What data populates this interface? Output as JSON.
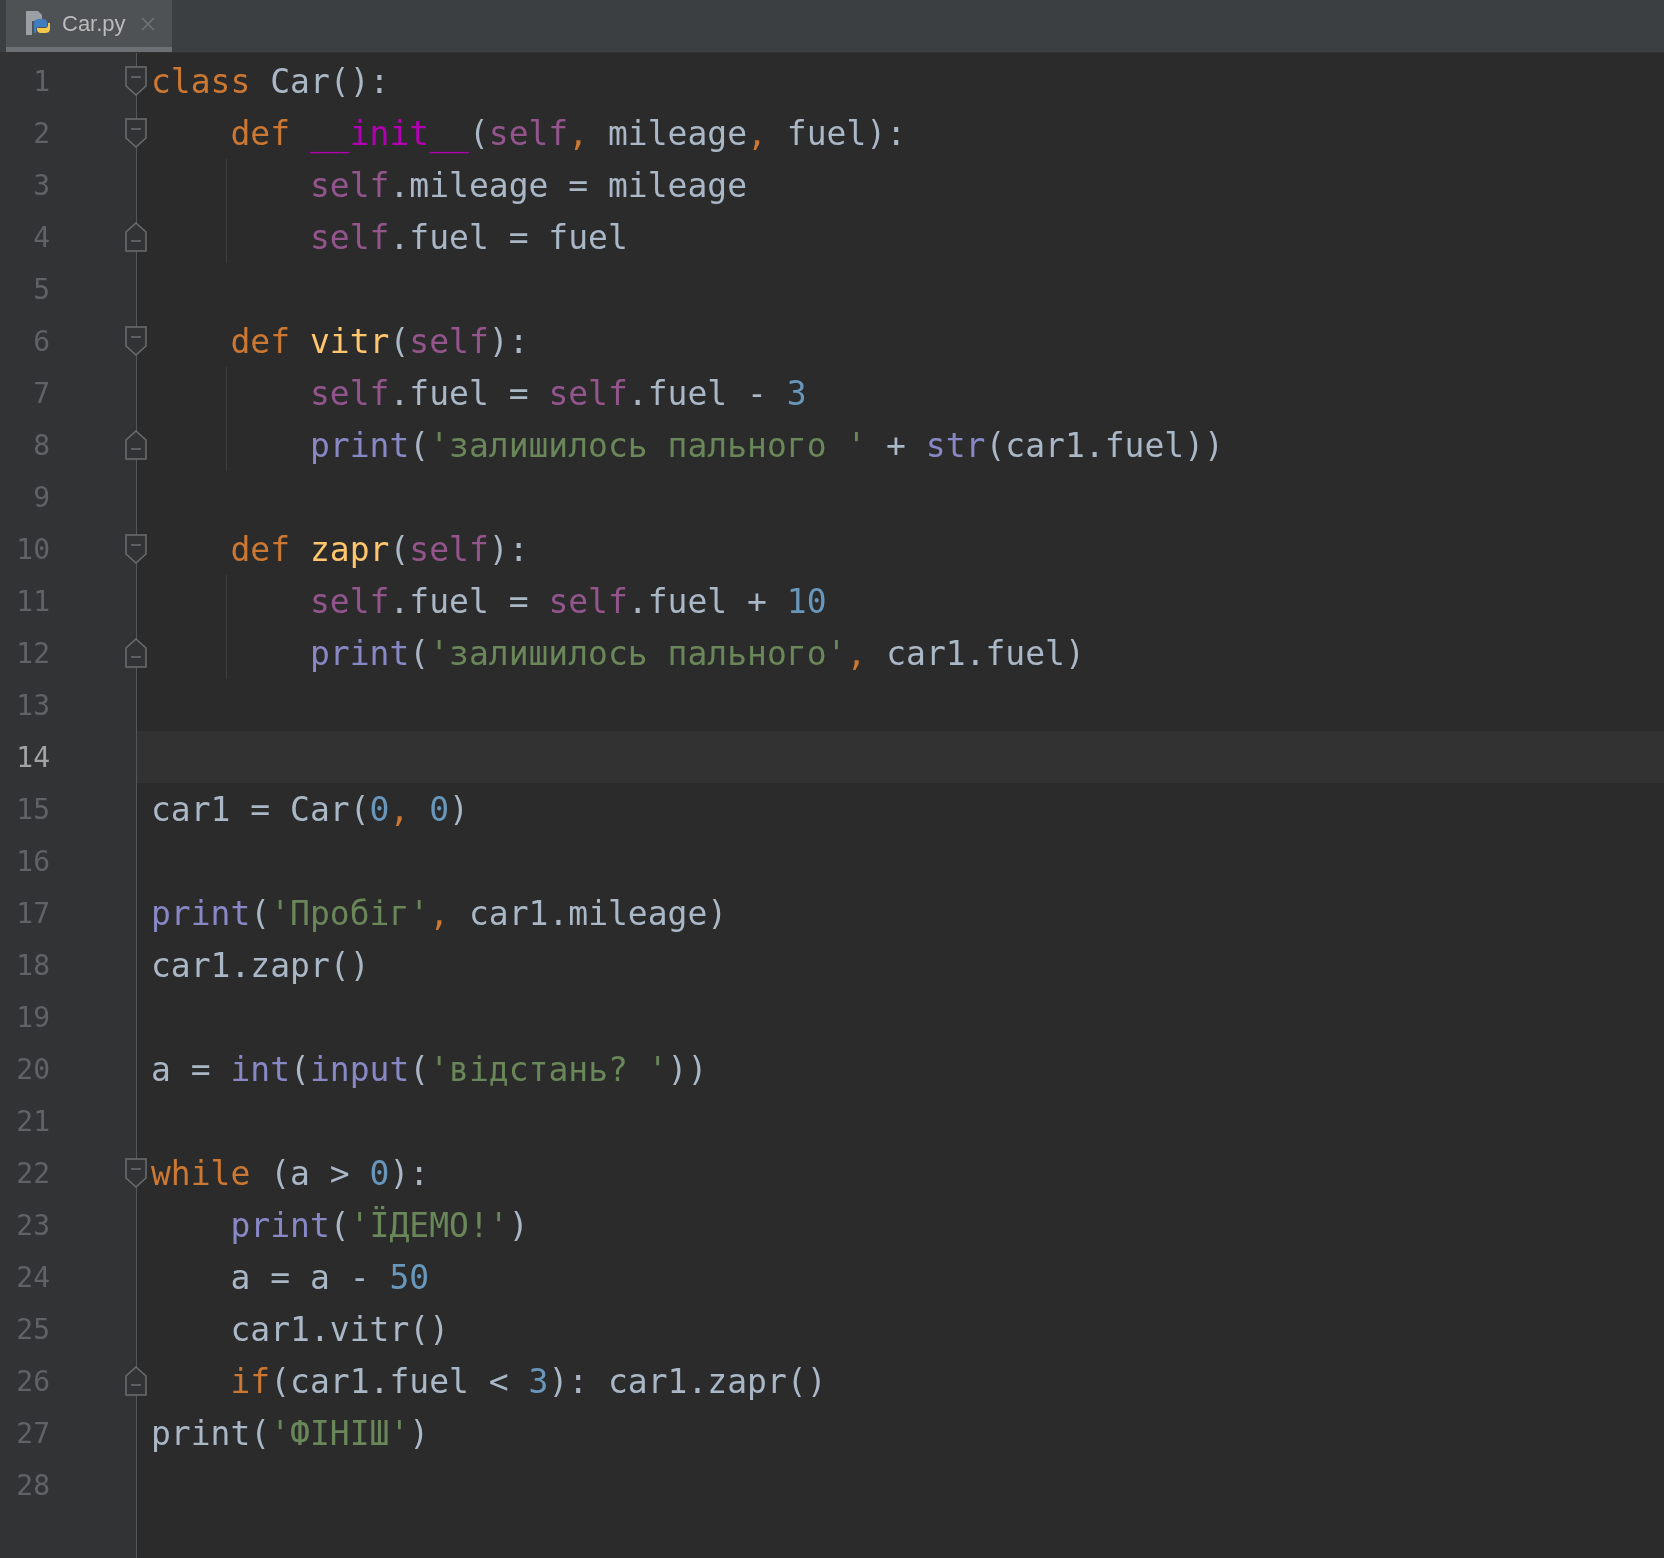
{
  "tabs": [
    {
      "label": "Car.py",
      "selected": true
    }
  ],
  "lines": [
    {
      "number": "1",
      "fold_start": true,
      "tokens": [
        {
          "kind": "kw",
          "text": "class"
        },
        {
          "kind": "plain",
          "text": " Car():"
        }
      ]
    },
    {
      "number": "2",
      "fold_start": true,
      "tokens": [
        {
          "kind": "kw",
          "text": "    def"
        },
        {
          "kind": "magic",
          "text": " __init__"
        },
        {
          "kind": "plain",
          "text": "("
        },
        {
          "kind": "self",
          "text": "self"
        },
        {
          "kind": "kw",
          "text": ", "
        },
        {
          "kind": "plain",
          "text": "mileage"
        },
        {
          "kind": "kw",
          "text": ", "
        },
        {
          "kind": "plain",
          "text": "fuel):"
        }
      ]
    },
    {
      "number": "3",
      "guide": true,
      "tokens": [
        {
          "kind": "self",
          "text": "        self"
        },
        {
          "kind": "plain",
          "text": ".mileage = mileage"
        }
      ]
    },
    {
      "number": "4",
      "guide": true,
      "fold_end": true,
      "tokens": [
        {
          "kind": "self",
          "text": "        self"
        },
        {
          "kind": "plain",
          "text": ".fuel = fuel"
        }
      ]
    },
    {
      "number": "5"
    },
    {
      "number": "6",
      "fold_start": true,
      "tokens": [
        {
          "kind": "kw",
          "text": "    def"
        },
        {
          "kind": "fn",
          "text": " vitr"
        },
        {
          "kind": "plain",
          "text": "("
        },
        {
          "kind": "self",
          "text": "self"
        },
        {
          "kind": "plain",
          "text": "):"
        }
      ]
    },
    {
      "number": "7",
      "guide": true,
      "tokens": [
        {
          "kind": "self",
          "text": "        self"
        },
        {
          "kind": "plain",
          "text": ".fuel = "
        },
        {
          "kind": "self",
          "text": "self"
        },
        {
          "kind": "plain",
          "text": ".fuel - "
        },
        {
          "kind": "num",
          "text": "3"
        }
      ]
    },
    {
      "number": "8",
      "guide": true,
      "fold_end": true,
      "tokens": [
        {
          "kind": "builtin",
          "text": "        print"
        },
        {
          "kind": "plain",
          "text": "("
        },
        {
          "kind": "str",
          "text": "'залишилось пального '"
        },
        {
          "kind": "plain",
          "text": " + "
        },
        {
          "kind": "builtin",
          "text": "str"
        },
        {
          "kind": "plain",
          "text": "(car1.fuel))"
        }
      ]
    },
    {
      "number": "9"
    },
    {
      "number": "10",
      "fold_start": true,
      "tokens": [
        {
          "kind": "kw",
          "text": "    def"
        },
        {
          "kind": "fn",
          "text": " zapr"
        },
        {
          "kind": "plain",
          "text": "("
        },
        {
          "kind": "self",
          "text": "self"
        },
        {
          "kind": "plain",
          "text": "):"
        }
      ]
    },
    {
      "number": "11",
      "guide": true,
      "tokens": [
        {
          "kind": "self",
          "text": "        self"
        },
        {
          "kind": "plain",
          "text": ".fuel = "
        },
        {
          "kind": "self",
          "text": "self"
        },
        {
          "kind": "plain",
          "text": ".fuel + "
        },
        {
          "kind": "num",
          "text": "10"
        }
      ]
    },
    {
      "number": "12",
      "guide": true,
      "fold_end": true,
      "tokens": [
        {
          "kind": "builtin",
          "text": "        print"
        },
        {
          "kind": "plain",
          "text": "("
        },
        {
          "kind": "str",
          "text": "'залишилось пального'"
        },
        {
          "kind": "kw",
          "text": ", "
        },
        {
          "kind": "plain",
          "text": "car1.fuel)"
        }
      ]
    },
    {
      "number": "13"
    },
    {
      "number": "14",
      "current": true
    },
    {
      "number": "15",
      "tokens": [
        {
          "kind": "plain",
          "text": "car1 = Car("
        },
        {
          "kind": "num",
          "text": "0"
        },
        {
          "kind": "kw",
          "text": ", "
        },
        {
          "kind": "num",
          "text": "0"
        },
        {
          "kind": "plain",
          "text": ")"
        }
      ]
    },
    {
      "number": "16"
    },
    {
      "number": "17",
      "tokens": [
        {
          "kind": "builtin",
          "text": "print"
        },
        {
          "kind": "plain",
          "text": "("
        },
        {
          "kind": "str",
          "text": "'Пробіг'"
        },
        {
          "kind": "kw",
          "text": ", "
        },
        {
          "kind": "plain",
          "text": "car1.mileage)"
        }
      ]
    },
    {
      "number": "18",
      "tokens": [
        {
          "kind": "plain",
          "text": "car1.zapr()"
        }
      ]
    },
    {
      "number": "19"
    },
    {
      "number": "20",
      "tokens": [
        {
          "kind": "plain",
          "text": "a = "
        },
        {
          "kind": "builtin",
          "text": "int"
        },
        {
          "kind": "plain",
          "text": "("
        },
        {
          "kind": "builtin",
          "text": "input"
        },
        {
          "kind": "plain",
          "text": "("
        },
        {
          "kind": "str",
          "text": "'відстань? '"
        },
        {
          "kind": "plain",
          "text": "))"
        }
      ]
    },
    {
      "number": "21"
    },
    {
      "number": "22",
      "fold_start": true,
      "tokens": [
        {
          "kind": "kw",
          "text": "while"
        },
        {
          "kind": "plain",
          "text": " (a > "
        },
        {
          "kind": "num",
          "text": "0"
        },
        {
          "kind": "plain",
          "text": "):"
        }
      ]
    },
    {
      "number": "23",
      "tokens": [
        {
          "kind": "builtin",
          "text": "    print"
        },
        {
          "kind": "plain",
          "text": "("
        },
        {
          "kind": "str",
          "text": "'ЇДЕМО!'"
        },
        {
          "kind": "plain",
          "text": ")"
        }
      ]
    },
    {
      "number": "24",
      "tokens": [
        {
          "kind": "plain",
          "text": "    a = a - "
        },
        {
          "kind": "num",
          "text": "50"
        }
      ]
    },
    {
      "number": "25",
      "tokens": [
        {
          "kind": "plain",
          "text": "    car1.vitr()"
        }
      ]
    },
    {
      "number": "26",
      "fold_end": true,
      "tokens": [
        {
          "kind": "kw",
          "text": "    if"
        },
        {
          "kind": "plain",
          "text": "(car1.fuel < "
        },
        {
          "kind": "num",
          "text": "3"
        },
        {
          "kind": "plain",
          "text": "): car1.zapr()"
        }
      ]
    },
    {
      "number": "27",
      "tokens": [
        {
          "kind": "plain",
          "text": "print("
        },
        {
          "kind": "str",
          "text": "'ФІНІШ'"
        },
        {
          "kind": "plain",
          "text": ")"
        }
      ]
    },
    {
      "number": "28"
    }
  ]
}
